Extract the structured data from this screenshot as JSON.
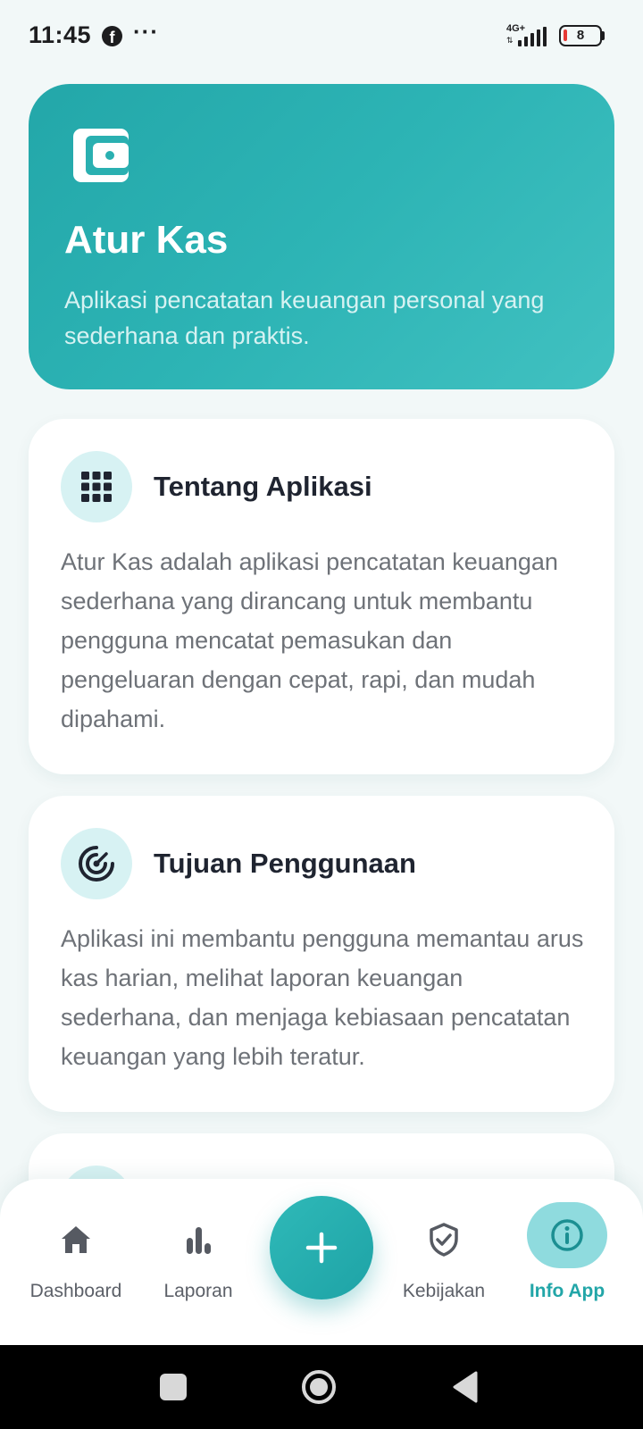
{
  "status_bar": {
    "time": "11:45",
    "facebook_glyph": "f",
    "more_glyph": "···",
    "network": "4G+",
    "network_arrows": "⇅",
    "battery_level": "8",
    "battery_color": "#e53935"
  },
  "hero": {
    "icon": "wallet-icon",
    "title": "Atur Kas",
    "description": "Aplikasi pencatatan keuangan personal yang sederhana dan praktis.",
    "gradient_start": "#23a7a9",
    "gradient_end": "#41c1c1"
  },
  "cards": [
    {
      "icon": "grid-icon",
      "title": "Tentang Aplikasi",
      "body": "Atur Kas adalah aplikasi pencatatan keuangan sederhana yang dirancang untuk membantu pengguna mencatat pemasukan dan pengeluaran dengan cepat, rapi, dan mudah dipahami."
    },
    {
      "icon": "target-icon",
      "title": "Tujuan Penggunaan",
      "body": "Aplikasi ini membantu pengguna memantau arus kas harian, melihat laporan keuangan sederhana, dan menjaga kebiasaan pencatatan keuangan yang lebih teratur."
    },
    {
      "icon": "card-icon",
      "title": "",
      "body": ""
    }
  ],
  "bottom_nav": {
    "items": [
      {
        "label": "Dashboard",
        "icon": "home-icon",
        "active": false
      },
      {
        "label": "Laporan",
        "icon": "bar-chart-icon",
        "active": false
      },
      {
        "label": "Kebijakan",
        "icon": "shield-check-icon",
        "active": false
      },
      {
        "label": "Info App",
        "icon": "info-icon",
        "active": true
      }
    ],
    "fab_icon": "plus-icon",
    "active_color": "#22a6a8"
  },
  "system_nav": {
    "buttons": [
      "recents",
      "home",
      "back"
    ]
  }
}
